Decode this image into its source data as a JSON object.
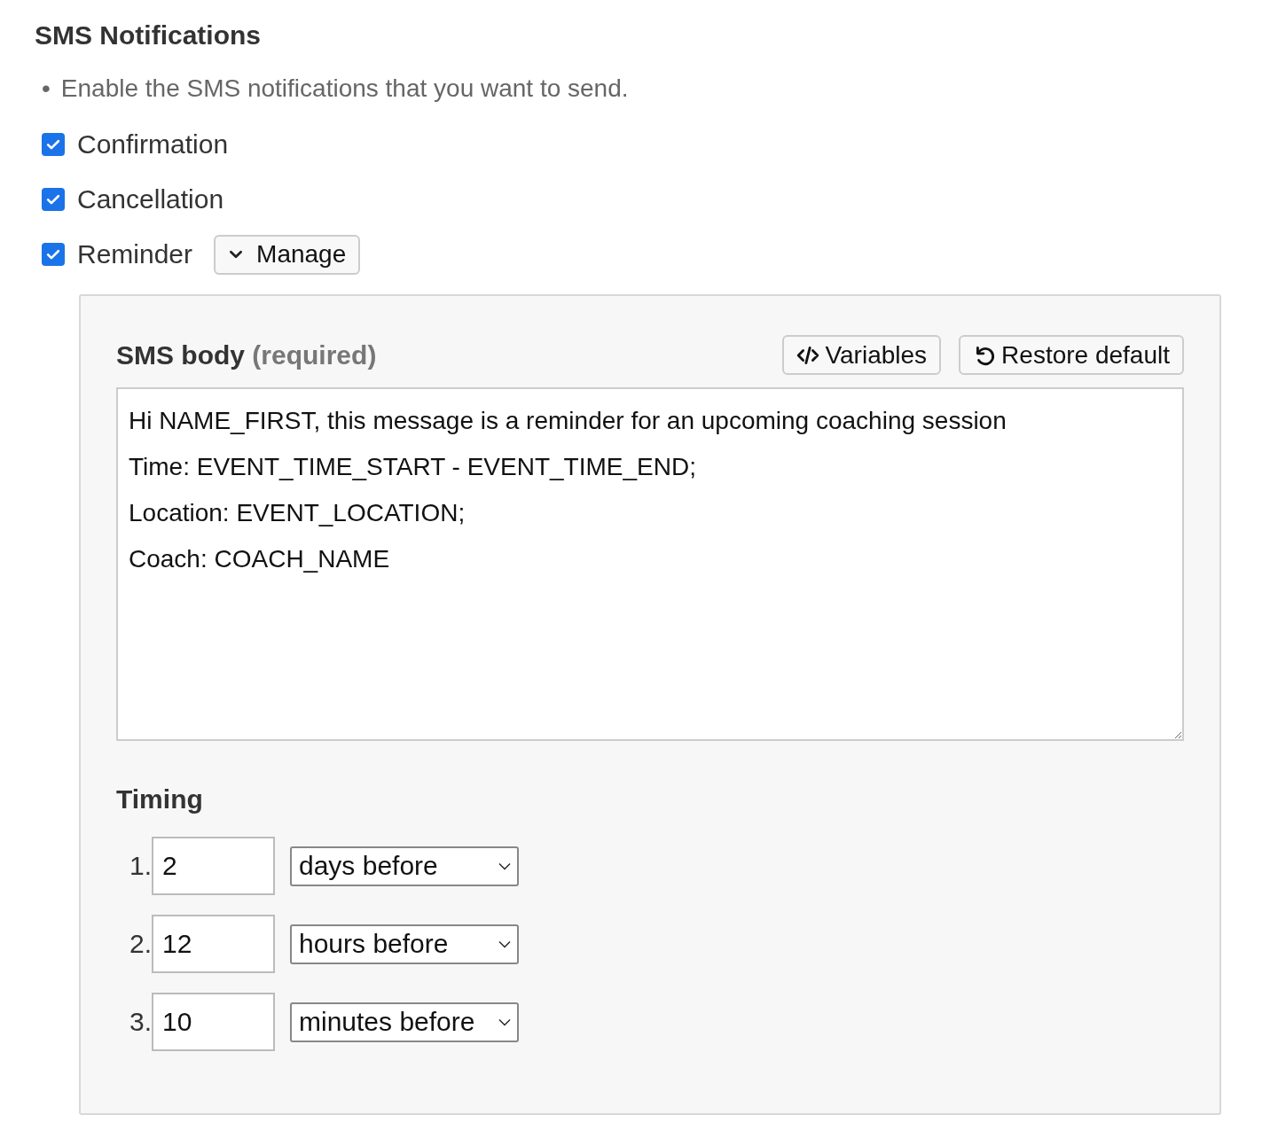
{
  "heading": "SMS Notifications",
  "hints": [
    {
      "marker": "•",
      "text": "Enable the SMS notifications that you want to send."
    }
  ],
  "notifications": [
    {
      "label": "Confirmation",
      "checked": true
    },
    {
      "label": "Cancellation",
      "checked": true
    },
    {
      "label": "Reminder",
      "checked": true,
      "manage_button": "Manage"
    }
  ],
  "panel": {
    "body_label": "SMS body",
    "body_note": "(required)",
    "buttons": [
      {
        "kind": "variables",
        "label": "Variables"
      },
      {
        "kind": "restore",
        "label": "Restore default"
      }
    ],
    "body_lines": [
      "Hi NAME_FIRST, this message is a reminder for an upcoming coaching session",
      "Time: EVENT_TIME_START - EVENT_TIME_END;",
      "Location: EVENT_LOCATION;",
      "Coach: COACH_NAME"
    ],
    "timing_label": "Timing",
    "timings": [
      {
        "number": "1.",
        "value": "2",
        "unit": "days before"
      },
      {
        "number": "2.",
        "value": "12",
        "unit": "hours before"
      },
      {
        "number": "3.",
        "value": "10",
        "unit": "minutes before"
      }
    ]
  }
}
